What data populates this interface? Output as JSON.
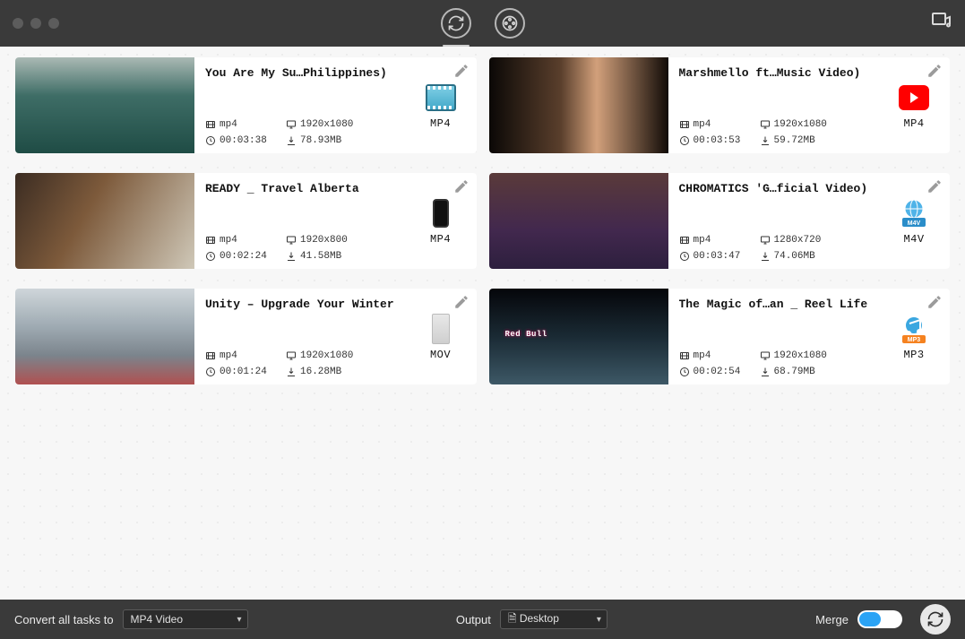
{
  "footer": {
    "convert_all_label": "Convert all tasks to",
    "convert_all_value": "MP4 Video",
    "output_label": "Output",
    "output_value": "🗎 Desktop",
    "merge_label": "Merge"
  },
  "items": [
    {
      "title": "You Are My Su…Philippines)",
      "format": "mp4",
      "resolution": "1920x1080",
      "duration": "00:03:38",
      "size": "78.93MB",
      "target_label": "MP4",
      "target_icon": "mp4clip",
      "thumb": "thumb1"
    },
    {
      "title": "Marshmello ft…Music Video)",
      "format": "mp4",
      "resolution": "1920x1080",
      "duration": "00:03:53",
      "size": "59.72MB",
      "target_label": "MP4",
      "target_icon": "yt",
      "thumb": "thumb2"
    },
    {
      "title": "READY _ Travel Alberta",
      "format": "mp4",
      "resolution": "1920x800",
      "duration": "00:02:24",
      "size": "41.58MB",
      "target_label": "MP4",
      "target_icon": "phone",
      "thumb": "thumb3"
    },
    {
      "title": "CHROMATICS 'G…ficial Video)",
      "format": "mp4",
      "resolution": "1280x720",
      "duration": "00:03:47",
      "size": "74.06MB",
      "target_label": "M4V",
      "target_icon": "m4v",
      "thumb": "thumb4"
    },
    {
      "title": "Unity – Upgrade Your Winter",
      "format": "mp4",
      "resolution": "1920x1080",
      "duration": "00:01:24",
      "size": "16.28MB",
      "target_label": "MOV",
      "target_icon": "mov",
      "thumb": "thumb5"
    },
    {
      "title": "The Magic of…an _ Reel Life",
      "format": "mp4",
      "resolution": "1920x1080",
      "duration": "00:02:54",
      "size": "68.79MB",
      "target_label": "MP3",
      "target_icon": "mp3",
      "thumb": "thumb6"
    }
  ]
}
